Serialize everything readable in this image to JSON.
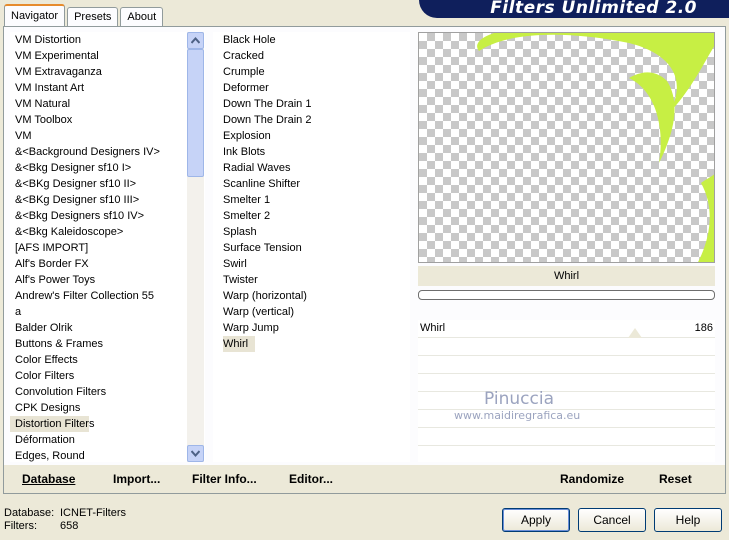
{
  "tabs": [
    "Navigator",
    "Presets",
    "About"
  ],
  "banner_title": "Filters Unlimited 2.0",
  "categories": [
    "VM Distortion",
    "VM Experimental",
    "VM Extravaganza",
    "VM Instant Art",
    "VM Natural",
    "VM Toolbox",
    "VM",
    "&<Background Designers IV>",
    "&<Bkg Designer sf10 I>",
    "&<BKg Designer sf10 II>",
    "&<BKg Designer sf10 III>",
    "&<Bkg Designers sf10 IV>",
    "&<Bkg Kaleidoscope>",
    "[AFS IMPORT]",
    "Alf's Border FX",
    "Alf's Power Toys",
    "Andrew's Filter Collection 55",
    "a",
    "Balder Olrik",
    "Buttons & Frames",
    "Color Effects",
    "Color Filters",
    "Convolution Filters",
    "CPK Designs",
    "Distortion Filters",
    "Déformation",
    "Edges, Round"
  ],
  "selected_category": "Distortion Filters",
  "filters": [
    "Black Hole",
    "Cracked",
    "Crumple",
    "Deformer",
    "Down The Drain 1",
    "Down The Drain 2",
    "Explosion",
    "Ink Blots",
    "Radial Waves",
    "Scanline Shifter",
    "Smelter 1",
    "Smelter 2",
    "Splash",
    "Surface Tension",
    "Swirl",
    "Twister",
    "Warp (horizontal)",
    "Warp (vertical)",
    "Warp Jump",
    "Whirl"
  ],
  "selected_filter": "Whirl",
  "current_filter_name": "Whirl",
  "params": [
    {
      "label": "Whirl",
      "value": "186"
    }
  ],
  "watermark": {
    "line1": "Pinuccia",
    "line2": "www.maidiregrafica.eu"
  },
  "links": {
    "database": "Database",
    "import": "Import...",
    "filter_info": "Filter Info...",
    "editor": "Editor...",
    "randomize": "Randomize",
    "reset": "Reset"
  },
  "info": {
    "database_label": "Database:",
    "database_value": "ICNET-Filters",
    "filters_label": "Filters:",
    "filters_value": "658"
  },
  "buttons": {
    "apply": "Apply",
    "cancel": "Cancel",
    "help": "Help"
  },
  "colors": {
    "banner": "#0f1f5c",
    "preview_shape": "#c7ef44",
    "selection": "#e8e4d4"
  },
  "icons": {
    "scroll_up": "chevron-up-icon",
    "scroll_down": "chevron-down-icon"
  }
}
